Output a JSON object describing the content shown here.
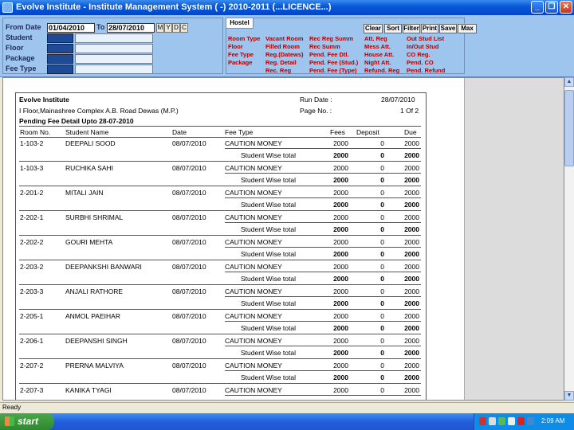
{
  "window": {
    "title": "Evolve Institute - Institute Management System ( -) 2010-2011 (...LICENCE...)",
    "controls": [
      "_",
      "❐",
      "✕"
    ]
  },
  "filters": {
    "from_label": "From Date",
    "from_value": "01/04/2010",
    "to_label": "To",
    "to_value": "28/07/2010",
    "mode_buttons": [
      "M",
      "Y",
      "D",
      "C"
    ],
    "fields": [
      "Student",
      "Floor",
      "Package",
      "Fee Type"
    ]
  },
  "hostel": {
    "tab_label": "Hostel",
    "actions": [
      "Clear",
      "Sort",
      "Filter",
      "Print",
      "Save",
      "Max"
    ],
    "reports": [
      [
        "Room Type",
        "Vacant Room",
        "Rec Reg Summ",
        "Att. Reg",
        "Out Stud List"
      ],
      [
        "Floor",
        "Filled Room",
        "Rec Summ",
        "Mess Att.",
        "In/Out Stud"
      ],
      [
        "Fee Type",
        "Reg.(Datews)",
        "Pend. Fee Dtl.",
        "House Att.",
        "CO Reg."
      ],
      [
        "Package",
        "Reg. Detail",
        "Pend. Fee (Stud.)",
        "Night Att.",
        "Pend. CO"
      ],
      [
        "",
        "Rec. Reg",
        "Pend. Fee (Type)",
        "Refund. Reg",
        "Pend. Refund"
      ]
    ]
  },
  "report": {
    "institute": "Evolve Institute",
    "address": "I Floor,Mainashree Complex A.B. Road Dewas (M.P.)",
    "heading": "Pending Fee Detail Upto 28-07-2010",
    "run_date_label": "Run Date :",
    "run_date": "28/07/2010",
    "page_label": "Page No. :",
    "page_value": "1 Of 2",
    "columns": [
      "Room No.",
      "Student Name",
      "Date",
      "Fee Type",
      "Fees",
      "Deposit",
      "Due"
    ],
    "subtotal_label": "Student Wise total",
    "rows": [
      {
        "room": "1-103-2",
        "name": "DEEPALI  SOOD",
        "date": "08/07/2010",
        "fee_type": "CAUTION MONEY",
        "fees": "2000",
        "deposit": "0",
        "due": "2000",
        "t_fees": "2000",
        "t_deposit": "0",
        "t_due": "2000"
      },
      {
        "room": "1-103-3",
        "name": "RUCHIKA  SAHI",
        "date": "08/07/2010",
        "fee_type": "CAUTION MONEY",
        "fees": "2000",
        "deposit": "0",
        "due": "2000",
        "t_fees": "2000",
        "t_deposit": "0",
        "t_due": "2000"
      },
      {
        "room": "2-201-2",
        "name": "MITALI  JAIN",
        "date": "08/07/2010",
        "fee_type": "CAUTION MONEY",
        "fees": "2000",
        "deposit": "0",
        "due": "2000",
        "t_fees": "2000",
        "t_deposit": "0",
        "t_due": "2000"
      },
      {
        "room": "2-202-1",
        "name": "SURBHI  SHRIMAL",
        "date": "08/07/2010",
        "fee_type": "CAUTION MONEY",
        "fees": "2000",
        "deposit": "0",
        "due": "2000",
        "t_fees": "2000",
        "t_deposit": "0",
        "t_due": "2000"
      },
      {
        "room": "2-202-2",
        "name": "GOURI  MEHTA",
        "date": "08/07/2010",
        "fee_type": "CAUTION MONEY",
        "fees": "2000",
        "deposit": "0",
        "due": "2000",
        "t_fees": "2000",
        "t_deposit": "0",
        "t_due": "2000"
      },
      {
        "room": "2-203-2",
        "name": "DEEPANKSHI  BANWARI",
        "date": "08/07/2010",
        "fee_type": "CAUTION MONEY",
        "fees": "2000",
        "deposit": "0",
        "due": "2000",
        "t_fees": "2000",
        "t_deposit": "0",
        "t_due": "2000"
      },
      {
        "room": "2-203-3",
        "name": "ANJALI  RATHORE",
        "date": "08/07/2010",
        "fee_type": "CAUTION MONEY",
        "fees": "2000",
        "deposit": "0",
        "due": "2000",
        "t_fees": "2000",
        "t_deposit": "0",
        "t_due": "2000"
      },
      {
        "room": "2-205-1",
        "name": "ANMOL  PAEIHAR",
        "date": "08/07/2010",
        "fee_type": "CAUTION MONEY",
        "fees": "2000",
        "deposit": "0",
        "due": "2000",
        "t_fees": "2000",
        "t_deposit": "0",
        "t_due": "2000"
      },
      {
        "room": "2-206-1",
        "name": "DEEPANSHI  SINGH",
        "date": "08/07/2010",
        "fee_type": "CAUTION MONEY",
        "fees": "2000",
        "deposit": "0",
        "due": "2000",
        "t_fees": "2000",
        "t_deposit": "0",
        "t_due": "2000"
      },
      {
        "room": "2-207-2",
        "name": "PRERNA  MALVIYA",
        "date": "08/07/2010",
        "fee_type": "CAUTION MONEY",
        "fees": "2000",
        "deposit": "0",
        "due": "2000",
        "t_fees": "2000",
        "t_deposit": "0",
        "t_due": "2000"
      },
      {
        "room": "2-207-3",
        "name": "KANIKA  TYAGI",
        "date": "08/07/2010",
        "fee_type": "CAUTION MONEY",
        "fees": "2000",
        "deposit": "0",
        "due": "2000",
        "t_fees": "",
        "t_deposit": "",
        "t_due": ""
      }
    ]
  },
  "status": {
    "text": "Ready"
  },
  "taskbar": {
    "start_label": "start",
    "clock": "2:09 AM"
  },
  "colors": {
    "title_bar": "#0a5ad8",
    "top_panel": "#9ec5ee",
    "report_links": "#b00000",
    "navy_field": "#1e4a96"
  }
}
